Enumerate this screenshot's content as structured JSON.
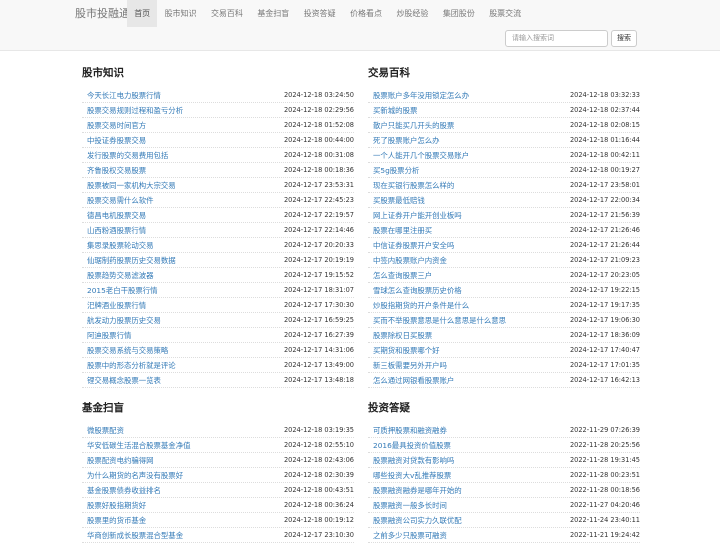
{
  "brand": "股市投融通",
  "nav": [
    {
      "label": "首页",
      "active": true
    },
    {
      "label": "股市知识"
    },
    {
      "label": "交易百科"
    },
    {
      "label": "基金扫盲"
    },
    {
      "label": "投资答疑"
    },
    {
      "label": "价格看点"
    },
    {
      "label": "炒股经验"
    },
    {
      "label": "集团股份"
    },
    {
      "label": "股票交流"
    }
  ],
  "search": {
    "placeholder": "请输入搜索词",
    "button": "搜索"
  },
  "panels": [
    {
      "key": "stock-knowledge",
      "title": "股市知识",
      "items": [
        {
          "title": "今天长江电力股票行情",
          "date": "2024-12-18 03:24:50"
        },
        {
          "title": "股票交易规则过程和盈亏分析",
          "date": "2024-12-18 02:29:56"
        },
        {
          "title": "股票交易时间官方",
          "date": "2024-12-18 01:52:08"
        },
        {
          "title": "中投证券股票交易",
          "date": "2024-12-18 00:44:00"
        },
        {
          "title": "发行股票的交易费用包括",
          "date": "2024-12-18 00:31:08"
        },
        {
          "title": "齐鲁股权交易股票",
          "date": "2024-12-18 00:18:36"
        },
        {
          "title": "股票被同一家机构大宗交易",
          "date": "2024-12-17 23:53:31"
        },
        {
          "title": "股票交易需什么软件",
          "date": "2024-12-17 22:45:23"
        },
        {
          "title": "德昌电机股票交易",
          "date": "2024-12-17 22:19:57"
        },
        {
          "title": "山西粉酒股票行情",
          "date": "2024-12-17 22:14:46"
        },
        {
          "title": "集思录股票轮动交易",
          "date": "2024-12-17 20:20:33"
        },
        {
          "title": "仙琚制药股票历史交易数据",
          "date": "2024-12-17 20:19:19"
        },
        {
          "title": "股票趋势交易滤波器",
          "date": "2024-12-17 19:15:52"
        },
        {
          "title": "2015老白干股票行情",
          "date": "2024-12-17 18:31:07"
        },
        {
          "title": "汜牌酒业股票行情",
          "date": "2024-12-17 17:30:30"
        },
        {
          "title": "航发动力股票历史交易",
          "date": "2024-12-17 16:59:25"
        },
        {
          "title": "阿迪股票行情",
          "date": "2024-12-17 16:27:39"
        },
        {
          "title": "股票交易系统与交易策略",
          "date": "2024-12-17 14:31:06"
        },
        {
          "title": "股票中的形态分析就是评论",
          "date": "2024-12-17 13:49:00"
        },
        {
          "title": "锂交易概念股票一览表",
          "date": "2024-12-17 13:48:18"
        }
      ]
    },
    {
      "key": "trading-encyclopedia",
      "title": "交易百科",
      "items": [
        {
          "title": "股票账户多年没用锁定怎么办",
          "date": "2024-12-18 03:32:33"
        },
        {
          "title": "买新城的股票",
          "date": "2024-12-18 02:37:44"
        },
        {
          "title": "散户只能买几开头的股票",
          "date": "2024-12-18 02:08:15"
        },
        {
          "title": "死了股票账户怎么办",
          "date": "2024-12-18 01:16:44"
        },
        {
          "title": "一个人能开几个股票交易账户",
          "date": "2024-12-18 00:42:11"
        },
        {
          "title": "买5g股票分析",
          "date": "2024-12-18 00:19:27"
        },
        {
          "title": "现在买银行股票怎么样的",
          "date": "2024-12-17 23:58:01"
        },
        {
          "title": "买股票最低赔钱",
          "date": "2024-12-17 22:00:34"
        },
        {
          "title": "网上证券开户能开创业板吗",
          "date": "2024-12-17 21:56:39"
        },
        {
          "title": "股票在哪里注册买",
          "date": "2024-12-17 21:26:46"
        },
        {
          "title": "中信证券股票开户安全吗",
          "date": "2024-12-17 21:26:44"
        },
        {
          "title": "中签内股票账户内资金",
          "date": "2024-12-17 21:09:23"
        },
        {
          "title": "怎么查询股票三户",
          "date": "2024-12-17 20:23:05"
        },
        {
          "title": "雪球怎么查询股票历史价格",
          "date": "2024-12-17 19:22:15"
        },
        {
          "title": "炒股指期货的开户条件是什么",
          "date": "2024-12-17 19:17:35"
        },
        {
          "title": "买而不举股票意思是什么意思是什么意思",
          "date": "2024-12-17 19:06:30"
        },
        {
          "title": "股票除权日买股票",
          "date": "2024-12-17 18:36:09"
        },
        {
          "title": "买期货和股票哪个好",
          "date": "2024-12-17 17:40:47"
        },
        {
          "title": "新三板需要另外开户吗",
          "date": "2024-12-17 17:01:35"
        },
        {
          "title": "怎么通过网银看股票账户",
          "date": "2024-12-17 16:42:13"
        }
      ]
    },
    {
      "key": "fund-basics",
      "title": "基金扫盲",
      "items": [
        {
          "title": "微股票配资",
          "date": "2024-12-18 03:19:35"
        },
        {
          "title": "华安低碳生活混合股票基金净值",
          "date": "2024-12-18 02:55:10"
        },
        {
          "title": "股票配资电约骗得网",
          "date": "2024-12-18 02:43:06"
        },
        {
          "title": "为什么期货的名声没有股票好",
          "date": "2024-12-18 02:30:39"
        },
        {
          "title": "基金股票债券收益排名",
          "date": "2024-12-18 00:43:51"
        },
        {
          "title": "股票好股指期货好",
          "date": "2024-12-18 00:36:24"
        },
        {
          "title": "股票里的货币基金",
          "date": "2024-12-18 00:19:12"
        },
        {
          "title": "华商创新成长股票混合型基金",
          "date": "2024-12-17 23:10:30"
        }
      ]
    },
    {
      "key": "investment-qa",
      "title": "投资答疑",
      "items": [
        {
          "title": "可质押股票和融资融券",
          "date": "2022-11-29 07:26:39"
        },
        {
          "title": "2016最具投资价值股票",
          "date": "2022-11-28 20:25:56"
        },
        {
          "title": "股票融资对贷款有影响吗",
          "date": "2022-11-28 19:31:45"
        },
        {
          "title": "哪些投资大v乱推荐股票",
          "date": "2022-11-28 00:23:51"
        },
        {
          "title": "股票融资融券是哪年开始的",
          "date": "2022-11-28 00:18:56"
        },
        {
          "title": "股票融资一般多长时间",
          "date": "2022-11-27 04:20:46"
        },
        {
          "title": "股票融资公司实力久联优配",
          "date": "2022-11-24 23:40:11"
        },
        {
          "title": "之前多少只股票可融资",
          "date": "2022-11-21 19:24:42"
        }
      ]
    }
  ]
}
